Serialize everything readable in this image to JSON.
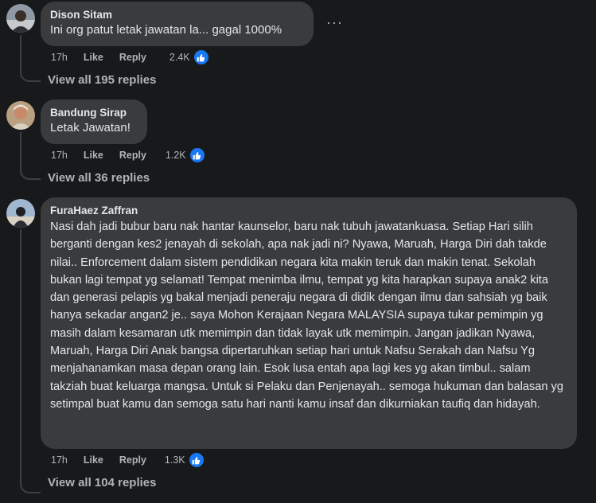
{
  "comments": [
    {
      "author": "Dison Sitam",
      "text": "Ini org patut letak jawatan la... gagal 1000%",
      "time": "17h",
      "like_label": "Like",
      "reply_label": "Reply",
      "reaction_count": "2.4K",
      "view_replies": "View all 195 replies",
      "more": "···"
    },
    {
      "author": "Bandung Sirap",
      "text": "Letak Jawatan!",
      "time": "17h",
      "like_label": "Like",
      "reply_label": "Reply",
      "reaction_count": "1.2K",
      "view_replies": "View all 36 replies"
    },
    {
      "author": "FuraHaez Zaffran",
      "text": "Nasi dah jadi bubur baru nak hantar kaunselor, baru nak tubuh jawatankuasa. Setiap Hari silih berganti dengan kes2 jenayah di sekolah, apa nak jadi ni? Nyawa, Maruah, Harga Diri dah takde nilai.. Enforcement dalam sistem pendidikan negara kita makin teruk dan makin tenat. Sekolah bukan lagi tempat yg selamat! Tempat menimba ilmu, tempat yg kita harapkan supaya anak2 kita dan generasi pelapis yg bakal menjadi peneraju negara di didik dengan ilmu dan sahsiah yg baik hanya sekadar angan2 je.. saya Mohon Kerajaan Negara MALAYSIA supaya tukar pemimpin yg masih dalam kesamaran utk memimpin dan tidak layak utk memimpin. Jangan jadikan Nyawa, Maruah, Harga Diri Anak bangsa dipertaruhkan setiap hari untuk Nafsu Serakah dan Nafsu Yg menjahanamkan masa depan orang lain. Esok lusa entah apa lagi kes yg akan timbul.. salam takziah buat keluarga mangsa. Untuk si Pelaku dan Penjenayah.. semoga hukuman dan balasan yg setimpal buat kamu dan semoga satu hari nanti kamu insaf dan dikurniakan taufiq dan hidayah.",
      "time": "17h",
      "like_label": "Like",
      "reply_label": "Reply",
      "reaction_count": "1.3K",
      "view_replies": "View all 104 replies"
    }
  ],
  "icons": {
    "reaction": "thumbs-up-icon",
    "more": "more-options-icon"
  },
  "colors": {
    "background": "#18191a",
    "bubble": "#3a3b3c",
    "primary_text": "#e4e6eb",
    "secondary_text": "#b0b3b8",
    "like_blue": "#1877f2"
  }
}
